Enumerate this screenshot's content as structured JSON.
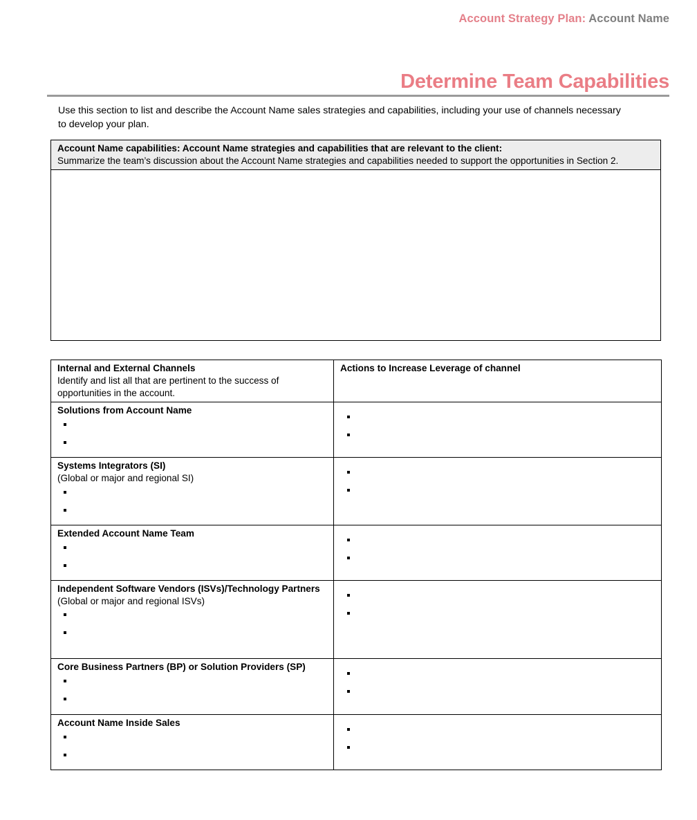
{
  "header": {
    "prefix": "Account Strategy Plan:",
    "account": " Account Name"
  },
  "title": "Determine Team Capabilities",
  "intro": "Use this section to list and describe the Account Name sales strategies and capabilities, including your use of channels necessary to develop your plan.",
  "capabilities": {
    "heading": "Account Name capabilities: Account Name strategies and capabilities that are relevant to the client:",
    "instruction": "Summarize the team’s discussion about the Account Name strategies and capabilities needed to support the opportunities in Section 2.",
    "answer": ""
  },
  "channels": {
    "col_left_title": "Internal and External Channels",
    "col_left_sub": "Identify and list all that are pertinent to the success of opportunities in the account.",
    "col_right_title": "Actions to Increase Leverage of channel",
    "rows": [
      {
        "title": "Solutions from Account Name",
        "sub": "",
        "left_bullets": [
          "",
          ""
        ],
        "right_bullets": [
          "",
          ""
        ]
      },
      {
        "title": "Systems Integrators (SI)",
        "sub": "(Global or major and regional SI)",
        "left_bullets": [
          "",
          ""
        ],
        "right_bullets": [
          "",
          ""
        ]
      },
      {
        "title": "Extended Account Name Team",
        "sub": "",
        "left_bullets": [
          "",
          ""
        ],
        "right_bullets": [
          "",
          ""
        ]
      },
      {
        "title": "Independent Software Vendors (ISVs)/Technology Partners",
        "sub": "(Global or major and regional ISVs)",
        "left_bullets": [
          "",
          ""
        ],
        "right_bullets": [
          "",
          ""
        ]
      },
      {
        "title": "Core Business Partners (BP) or Solution Providers (SP)",
        "sub": "",
        "left_bullets": [
          "",
          ""
        ],
        "right_bullets": [
          "",
          ""
        ]
      },
      {
        "title": "Account Name Inside Sales",
        "sub": "",
        "left_bullets": [
          "",
          ""
        ],
        "right_bullets": [
          "",
          ""
        ]
      }
    ]
  },
  "colors": {
    "accent_pink": "#ea7d85",
    "header_gray": "#7f7f7f",
    "rule_gray": "#9a9a9a",
    "cell_header_bg": "#ededed"
  }
}
